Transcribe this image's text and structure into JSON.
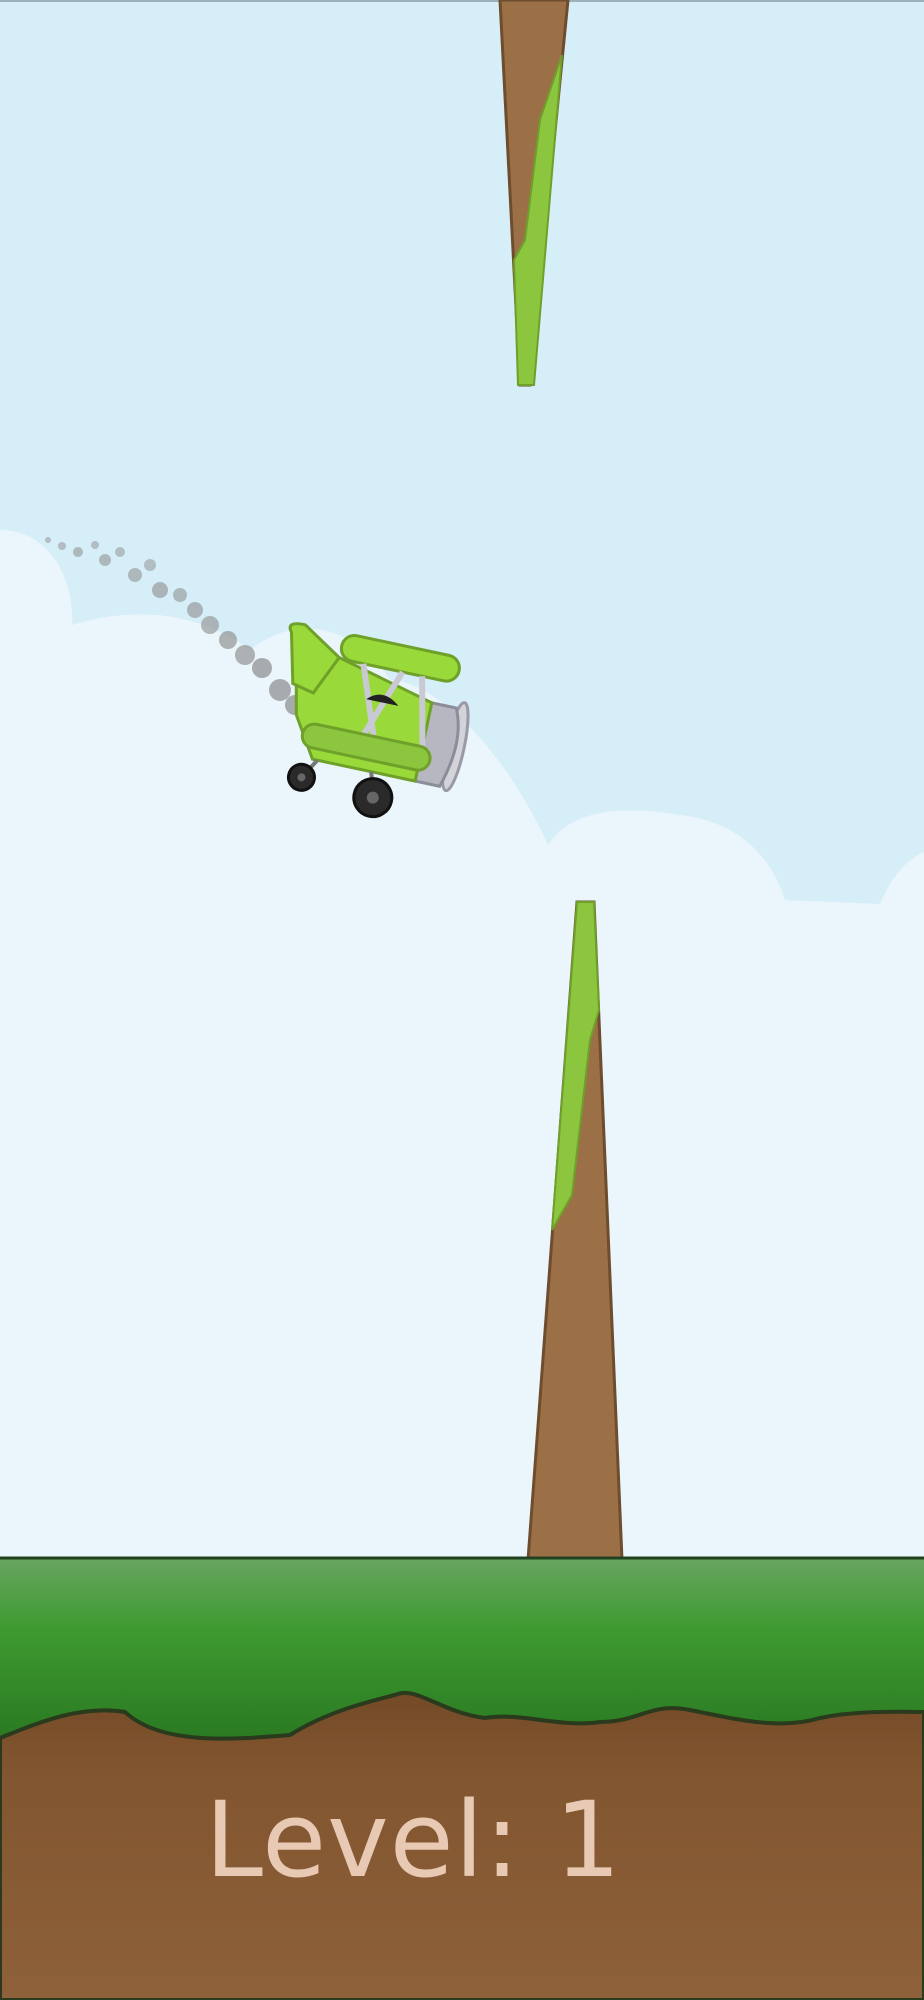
{
  "hud": {
    "level_label": "Level:",
    "level_value": "1"
  },
  "colors": {
    "sky": "#d6eef8",
    "cloud": "#eaf6fb",
    "grass": "#3c962e",
    "dirt": "#8a5d38",
    "rock": "#9b7046",
    "moss": "#8cc63f",
    "plane": "#9ad93a",
    "level_text": "#e7c9b4"
  },
  "icons": {
    "player": "biplane-icon",
    "obstacle": "rock-spike-icon",
    "trail": "smoke-trail-icon"
  }
}
